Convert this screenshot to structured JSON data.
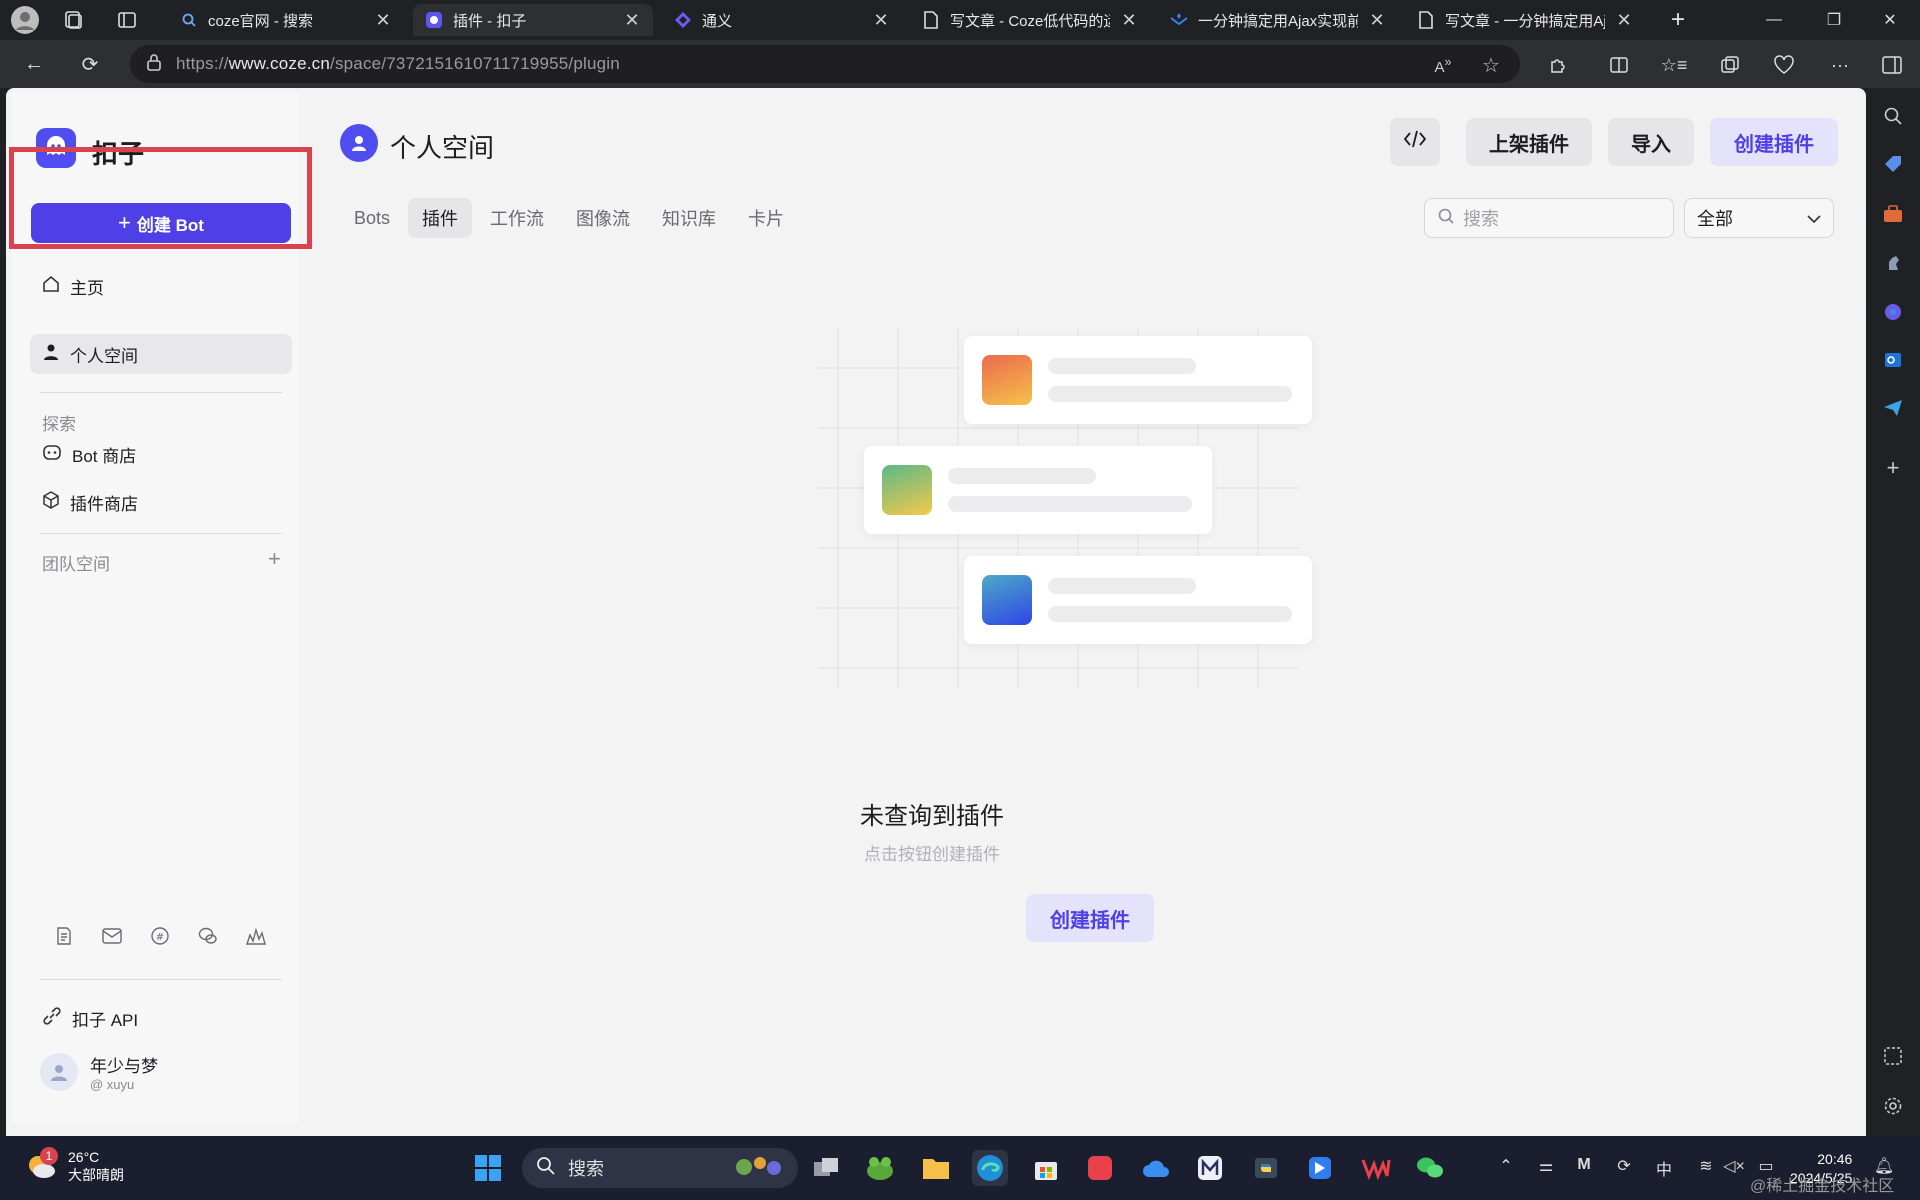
{
  "browser": {
    "tabs": [
      {
        "title": "coze官网 - 搜索",
        "icon": "search-icon"
      },
      {
        "title": "插件 - 扣子",
        "icon": "coze-icon"
      },
      {
        "title": "通义",
        "icon": "tongyi-icon"
      },
      {
        "title": "写文章 - Coze低代码的运",
        "icon": "page-icon"
      },
      {
        "title": "一分钟搞定用Ajax实现前",
        "icon": "juejin-icon"
      },
      {
        "title": "写文章 - 一分钟搞定用Aj",
        "icon": "page-icon"
      }
    ],
    "url_prefix": "https://",
    "url_domain": "www.coze.cn",
    "url_path": "/space/7372151610711719955/plugin"
  },
  "sidebar": {
    "brand": "扣子",
    "create_bot": "创建 Bot",
    "nav_home": "主页",
    "nav_personal": "个人空间",
    "section_explore": "探索",
    "nav_bot_store": "Bot 商店",
    "nav_plugin_store": "插件商店",
    "section_team": "团队空间",
    "api_label": "扣子 API",
    "user_name": "年少与梦",
    "user_id": "@ xuyu"
  },
  "header": {
    "title": "个人空间",
    "publish_plugin": "上架插件",
    "import": "导入",
    "create_plugin": "创建插件"
  },
  "tabs": [
    "Bots",
    "插件",
    "工作流",
    "图像流",
    "知识库",
    "卡片"
  ],
  "search": {
    "placeholder": "搜索"
  },
  "filter": {
    "selected": "全部"
  },
  "empty": {
    "title": "未查询到插件",
    "subtitle": "点击按钮创建插件",
    "button": "创建插件"
  },
  "taskbar": {
    "temperature": "26°C",
    "weather": "大部晴朗",
    "notif_count": "1",
    "search_label": "搜索",
    "ime": "中",
    "time": "20:46",
    "date": "2024/5/25"
  },
  "watermark": "@稀土掘金技术社区",
  "colors": {
    "accent": "#4e40e6",
    "highlight_box": "#d9434e"
  }
}
